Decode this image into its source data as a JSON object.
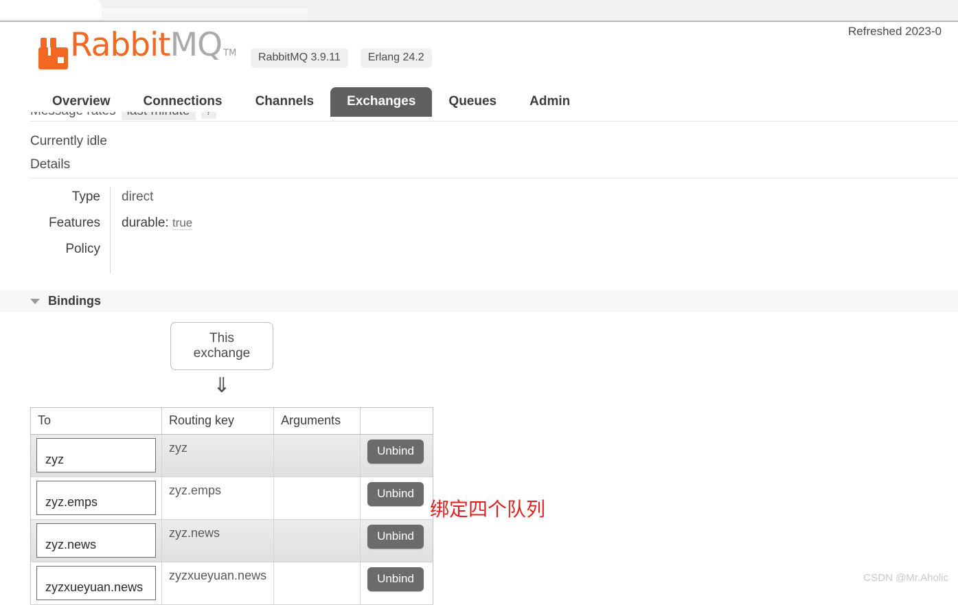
{
  "browser": {
    "tab_placeholder": ""
  },
  "header": {
    "logo_rabbit": "Rabbit",
    "logo_mq": "MQ",
    "logo_tm": "TM",
    "badges": [
      {
        "label": "RabbitMQ 3.9.11"
      },
      {
        "label": "Erlang 24.2"
      }
    ],
    "refreshed": "Refreshed 2023-0"
  },
  "nav": {
    "tabs": [
      {
        "label": "Overview",
        "active": false
      },
      {
        "label": "Connections",
        "active": false
      },
      {
        "label": "Channels",
        "active": false
      },
      {
        "label": "Exchanges",
        "active": true
      },
      {
        "label": "Queues",
        "active": false
      },
      {
        "label": "Admin",
        "active": false
      }
    ]
  },
  "message_rates": {
    "label": "Message rates",
    "period": "last minute",
    "help": "?"
  },
  "main": {
    "idle_text": "Currently idle",
    "details_heading": "Details",
    "details_rows": [
      {
        "label": "Type",
        "value": "direct",
        "value2": ""
      },
      {
        "label": "Features",
        "value": "durable:",
        "value2": "true"
      },
      {
        "label": "Policy",
        "value": "",
        "value2": ""
      }
    ]
  },
  "bindings": {
    "section_title": "Bindings",
    "exchange_box_label": "This exchange",
    "arrow": "⇓",
    "columns": [
      "To",
      "Routing key",
      "Arguments",
      ""
    ],
    "rows": [
      {
        "to": "zyz",
        "routing_key": "zyz",
        "arguments": "",
        "action": "Unbind"
      },
      {
        "to": "zyz.emps",
        "routing_key": "zyz.emps",
        "arguments": "",
        "action": "Unbind"
      },
      {
        "to": "zyz.news",
        "routing_key": "zyz.news",
        "arguments": "",
        "action": "Unbind"
      },
      {
        "to": "zyzxueyuan.news",
        "routing_key": "zyzxueyuan.news",
        "arguments": "",
        "action": "Unbind"
      }
    ]
  },
  "annotation": {
    "text": "绑定四个队列",
    "color": "#e02020"
  },
  "watermark": {
    "text": "CSDN @Mr.Aholic"
  },
  "colors": {
    "brand_orange": "#f26722",
    "active_tab": "#605e5e",
    "button_gray": "#6b6b6b",
    "section_band": "#f7f7f7"
  }
}
